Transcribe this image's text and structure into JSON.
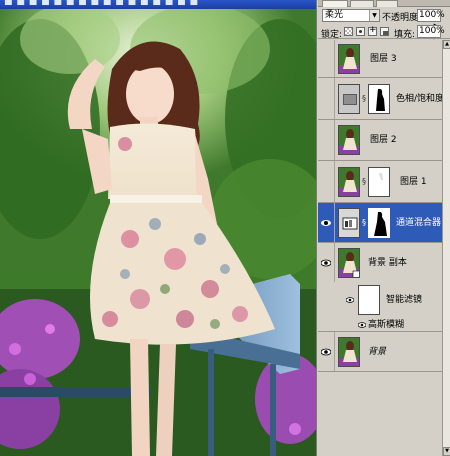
{
  "window": {
    "title_strip_text": "■ ■ ■ ■ ■ ■ ■ ■ ■ ■ ■ ■ ■ ■ ■ ■"
  },
  "layers_panel": {
    "tabs": [
      "layers-tab",
      "channels-tab",
      "paths-tab"
    ],
    "blend_mode": "柔光",
    "opacity_label": "不透明度:",
    "opacity_value": "100%",
    "lock_label": "锁定:",
    "fill_label": "填充:",
    "fill_value": "100%",
    "layers": [
      {
        "name": "图层 3",
        "visible": false,
        "selected": false,
        "thumb": "photo-thumb"
      },
      {
        "name": "色相/饱和度 1",
        "visible": false,
        "selected": false,
        "thumb": "adjustment-thumb",
        "has_mask": true
      },
      {
        "name": "图层 2",
        "visible": false,
        "selected": false,
        "thumb": "photo-thumb"
      },
      {
        "name": "图层 1",
        "visible": false,
        "selected": false,
        "thumb": "photo-thumb",
        "has_mask": true
      },
      {
        "name": "通道混合器 1",
        "visible": true,
        "selected": true,
        "thumb": "adjustment-thumb",
        "has_mask": true
      },
      {
        "name": "背景 副本",
        "visible": true,
        "selected": false,
        "thumb": "photo-thumb"
      },
      {
        "name": "背景",
        "visible": true,
        "selected": false,
        "thumb": "photo-thumb"
      }
    ],
    "smart_filters_label": "智能滤镜",
    "gaussian_blur_label": "高斯模糊"
  },
  "colors": {
    "panel_bg": "#d4d0c8",
    "selected_row": "#2e5bb8",
    "title_bar": "#2a55c8"
  }
}
